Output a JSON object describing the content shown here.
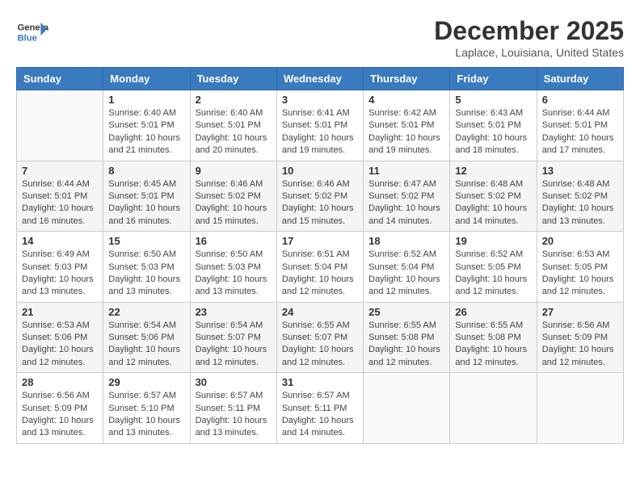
{
  "header": {
    "logo_line1": "General",
    "logo_line2": "Blue",
    "month": "December 2025",
    "location": "Laplace, Louisiana, United States"
  },
  "days_of_week": [
    "Sunday",
    "Monday",
    "Tuesday",
    "Wednesday",
    "Thursday",
    "Friday",
    "Saturday"
  ],
  "weeks": [
    [
      {
        "day": "",
        "sunrise": "",
        "sunset": "",
        "daylight": ""
      },
      {
        "day": "1",
        "sunrise": "Sunrise: 6:40 AM",
        "sunset": "Sunset: 5:01 PM",
        "daylight": "Daylight: 10 hours and 21 minutes."
      },
      {
        "day": "2",
        "sunrise": "Sunrise: 6:40 AM",
        "sunset": "Sunset: 5:01 PM",
        "daylight": "Daylight: 10 hours and 20 minutes."
      },
      {
        "day": "3",
        "sunrise": "Sunrise: 6:41 AM",
        "sunset": "Sunset: 5:01 PM",
        "daylight": "Daylight: 10 hours and 19 minutes."
      },
      {
        "day": "4",
        "sunrise": "Sunrise: 6:42 AM",
        "sunset": "Sunset: 5:01 PM",
        "daylight": "Daylight: 10 hours and 19 minutes."
      },
      {
        "day": "5",
        "sunrise": "Sunrise: 6:43 AM",
        "sunset": "Sunset: 5:01 PM",
        "daylight": "Daylight: 10 hours and 18 minutes."
      },
      {
        "day": "6",
        "sunrise": "Sunrise: 6:44 AM",
        "sunset": "Sunset: 5:01 PM",
        "daylight": "Daylight: 10 hours and 17 minutes."
      }
    ],
    [
      {
        "day": "7",
        "sunrise": "Sunrise: 6:44 AM",
        "sunset": "Sunset: 5:01 PM",
        "daylight": "Daylight: 10 hours and 16 minutes."
      },
      {
        "day": "8",
        "sunrise": "Sunrise: 6:45 AM",
        "sunset": "Sunset: 5:01 PM",
        "daylight": "Daylight: 10 hours and 16 minutes."
      },
      {
        "day": "9",
        "sunrise": "Sunrise: 6:46 AM",
        "sunset": "Sunset: 5:02 PM",
        "daylight": "Daylight: 10 hours and 15 minutes."
      },
      {
        "day": "10",
        "sunrise": "Sunrise: 6:46 AM",
        "sunset": "Sunset: 5:02 PM",
        "daylight": "Daylight: 10 hours and 15 minutes."
      },
      {
        "day": "11",
        "sunrise": "Sunrise: 6:47 AM",
        "sunset": "Sunset: 5:02 PM",
        "daylight": "Daylight: 10 hours and 14 minutes."
      },
      {
        "day": "12",
        "sunrise": "Sunrise: 6:48 AM",
        "sunset": "Sunset: 5:02 PM",
        "daylight": "Daylight: 10 hours and 14 minutes."
      },
      {
        "day": "13",
        "sunrise": "Sunrise: 6:48 AM",
        "sunset": "Sunset: 5:02 PM",
        "daylight": "Daylight: 10 hours and 13 minutes."
      }
    ],
    [
      {
        "day": "14",
        "sunrise": "Sunrise: 6:49 AM",
        "sunset": "Sunset: 5:03 PM",
        "daylight": "Daylight: 10 hours and 13 minutes."
      },
      {
        "day": "15",
        "sunrise": "Sunrise: 6:50 AM",
        "sunset": "Sunset: 5:03 PM",
        "daylight": "Daylight: 10 hours and 13 minutes."
      },
      {
        "day": "16",
        "sunrise": "Sunrise: 6:50 AM",
        "sunset": "Sunset: 5:03 PM",
        "daylight": "Daylight: 10 hours and 13 minutes."
      },
      {
        "day": "17",
        "sunrise": "Sunrise: 6:51 AM",
        "sunset": "Sunset: 5:04 PM",
        "daylight": "Daylight: 10 hours and 12 minutes."
      },
      {
        "day": "18",
        "sunrise": "Sunrise: 6:52 AM",
        "sunset": "Sunset: 5:04 PM",
        "daylight": "Daylight: 10 hours and 12 minutes."
      },
      {
        "day": "19",
        "sunrise": "Sunrise: 6:52 AM",
        "sunset": "Sunset: 5:05 PM",
        "daylight": "Daylight: 10 hours and 12 minutes."
      },
      {
        "day": "20",
        "sunrise": "Sunrise: 6:53 AM",
        "sunset": "Sunset: 5:05 PM",
        "daylight": "Daylight: 10 hours and 12 minutes."
      }
    ],
    [
      {
        "day": "21",
        "sunrise": "Sunrise: 6:53 AM",
        "sunset": "Sunset: 5:06 PM",
        "daylight": "Daylight: 10 hours and 12 minutes."
      },
      {
        "day": "22",
        "sunrise": "Sunrise: 6:54 AM",
        "sunset": "Sunset: 5:06 PM",
        "daylight": "Daylight: 10 hours and 12 minutes."
      },
      {
        "day": "23",
        "sunrise": "Sunrise: 6:54 AM",
        "sunset": "Sunset: 5:07 PM",
        "daylight": "Daylight: 10 hours and 12 minutes."
      },
      {
        "day": "24",
        "sunrise": "Sunrise: 6:55 AM",
        "sunset": "Sunset: 5:07 PM",
        "daylight": "Daylight: 10 hours and 12 minutes."
      },
      {
        "day": "25",
        "sunrise": "Sunrise: 6:55 AM",
        "sunset": "Sunset: 5:08 PM",
        "daylight": "Daylight: 10 hours and 12 minutes."
      },
      {
        "day": "26",
        "sunrise": "Sunrise: 6:55 AM",
        "sunset": "Sunset: 5:08 PM",
        "daylight": "Daylight: 10 hours and 12 minutes."
      },
      {
        "day": "27",
        "sunrise": "Sunrise: 6:56 AM",
        "sunset": "Sunset: 5:09 PM",
        "daylight": "Daylight: 10 hours and 12 minutes."
      }
    ],
    [
      {
        "day": "28",
        "sunrise": "Sunrise: 6:56 AM",
        "sunset": "Sunset: 5:09 PM",
        "daylight": "Daylight: 10 hours and 13 minutes."
      },
      {
        "day": "29",
        "sunrise": "Sunrise: 6:57 AM",
        "sunset": "Sunset: 5:10 PM",
        "daylight": "Daylight: 10 hours and 13 minutes."
      },
      {
        "day": "30",
        "sunrise": "Sunrise: 6:57 AM",
        "sunset": "Sunset: 5:11 PM",
        "daylight": "Daylight: 10 hours and 13 minutes."
      },
      {
        "day": "31",
        "sunrise": "Sunrise: 6:57 AM",
        "sunset": "Sunset: 5:11 PM",
        "daylight": "Daylight: 10 hours and 14 minutes."
      },
      {
        "day": "",
        "sunrise": "",
        "sunset": "",
        "daylight": ""
      },
      {
        "day": "",
        "sunrise": "",
        "sunset": "",
        "daylight": ""
      },
      {
        "day": "",
        "sunrise": "",
        "sunset": "",
        "daylight": ""
      }
    ]
  ]
}
